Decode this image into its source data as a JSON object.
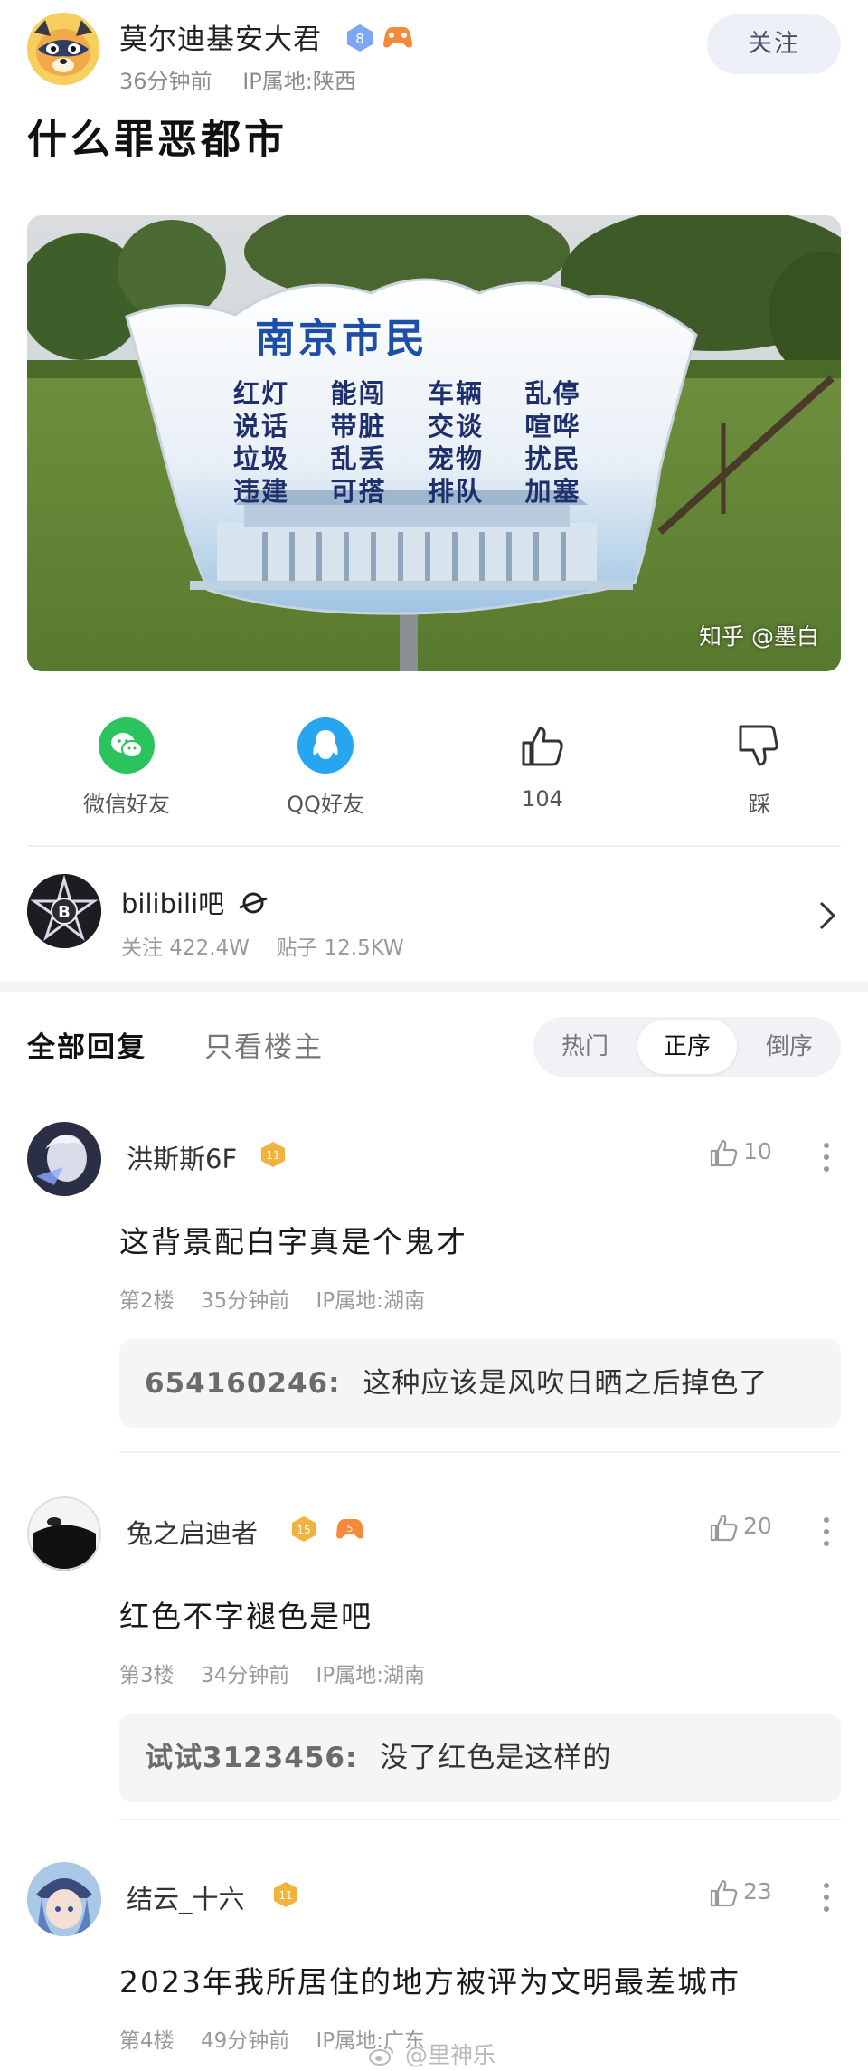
{
  "author": {
    "name": "莫尔迪基安大君",
    "level_badge": "8",
    "time": "36分钟前",
    "ip": "IP属地:陕西",
    "follow_label": "关注"
  },
  "post": {
    "title": "什么罪恶都市",
    "image": {
      "sign_title": "南京市民",
      "sign_rows": [
        [
          "红灯",
          "能闯",
          "车辆",
          "乱停"
        ],
        [
          "说话",
          "带脏",
          "交谈",
          "喧哗"
        ],
        [
          "垃圾",
          "乱丢",
          "宠物",
          "扰民"
        ],
        [
          "违建",
          "可搭",
          "排队",
          "加塞"
        ]
      ],
      "watermark": "知乎 @墨白"
    }
  },
  "share": {
    "wechat": "微信好友",
    "qq": "QQ好友",
    "like_count": "104",
    "dislike": "踩"
  },
  "forum": {
    "name": "bilibili吧",
    "follow_stat": "关注 422.4W",
    "post_stat": "贴子 12.5KW"
  },
  "tabs": {
    "all": "全部回复",
    "op_only": "只看楼主",
    "sort": [
      "热门",
      "正序",
      "倒序"
    ],
    "active_sort": "正序"
  },
  "comments": [
    {
      "name": "洪斯斯6F",
      "badge": "11",
      "likes": "10",
      "text": "这背景配白字真是个鬼才",
      "floor": "第2楼",
      "time": "35分钟前",
      "ip": "IP属地:湖南",
      "reply_name": "654160246:",
      "reply_text": "这种应该是风吹日晒之后掉色了"
    },
    {
      "name": "兔之启迪者",
      "badge": "15",
      "badge2": "5",
      "likes": "20",
      "text": "红色不字褪色是吧",
      "floor": "第3楼",
      "time": "34分钟前",
      "ip": "IP属地:湖南",
      "reply_name": "试试3123456:",
      "reply_text": "没了红色是这样的"
    },
    {
      "name": "结云_十六",
      "badge": "11",
      "likes": "23",
      "text": "2023年我所居住的地方被评为文明最差城市",
      "floor": "第4楼",
      "time": "49分钟前",
      "ip": "IP属地:广东"
    }
  ],
  "watermark_footer": "@里神乐",
  "colors": {
    "accent_blue": "#26a6f0",
    "wechat_green": "#2bc35e",
    "badge_gold": "#f2b33d",
    "follow_bg": "#eef0f7"
  }
}
